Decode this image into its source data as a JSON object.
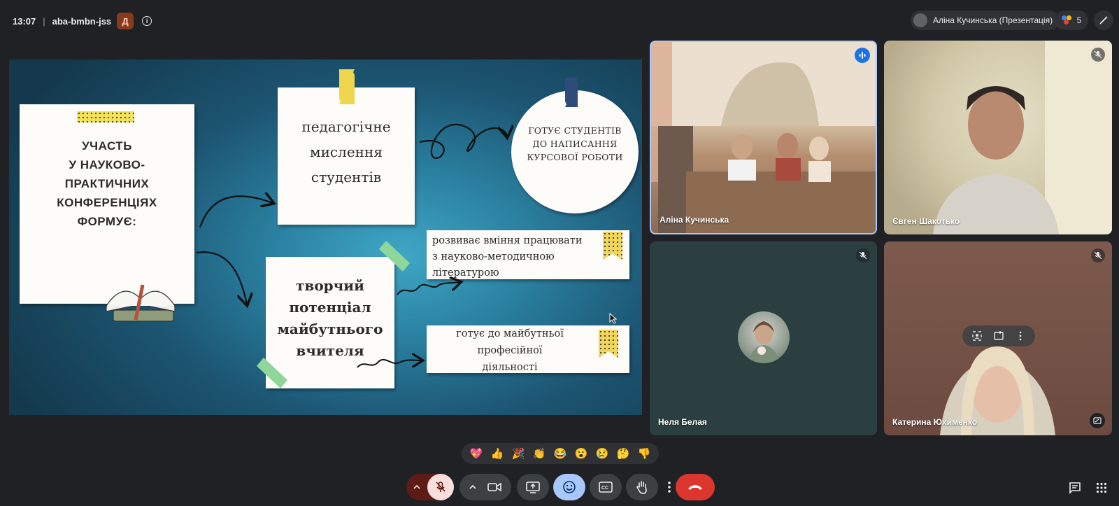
{
  "meeting": {
    "time": "13:07",
    "code": "aba-bmbn-jss",
    "host_badge": "Д",
    "info_icon": "info-icon"
  },
  "presenter_chip": {
    "label": "Аліна Кучинська (Презентація)"
  },
  "participants": {
    "count": "5"
  },
  "slide": {
    "main_title": [
      "УЧАСТЬ",
      "У НАУКОВО-",
      "ПРАКТИЧНИХ",
      "КОНФЕРЕНЦІЯХ",
      "ФОРМУЄ:"
    ],
    "card_ped": [
      "педагогічне",
      "мислення",
      "студентів"
    ],
    "circle": [
      "ГОТУЄ СТУДЕНТІВ",
      "ДО НАПИСАННЯ",
      "КУРСОВОЇ РОБОТИ"
    ],
    "card_tv": [
      "творчий",
      "потенціал",
      "майбутнього",
      "вчителя"
    ],
    "card_r1": [
      "розвиває вміння працювати",
      "з науково-методичною",
      "літературою"
    ],
    "card_r2": [
      "готує до майбутньої",
      "професійної",
      "діяльності"
    ]
  },
  "tiles": [
    {
      "name": "Аліна Кучинська",
      "state": "speaking"
    },
    {
      "name": "Євген Шакотько",
      "state": "muted"
    },
    {
      "name": "Неля Белая",
      "state": "muted"
    },
    {
      "name": "Катерина Юхименко",
      "state": "muted"
    }
  ],
  "reactions": [
    "💖",
    "👍",
    "🎉",
    "👏",
    "😂",
    "😮",
    "😢",
    "🤔",
    "👎"
  ],
  "colors": {
    "accent_blue": "#a8c7fa",
    "end_call_red": "#dc362e",
    "mic_muted_bg": "#f9dedc"
  },
  "controls": {
    "mic": "mic-off-icon",
    "camera": "videocam-icon",
    "present": "present-screen-icon",
    "reactions": "emoji-icon",
    "captions": "closed-captions-icon",
    "raise_hand": "hand-icon",
    "more": "more-vert-icon",
    "end_call": "call-end-icon",
    "chat": "chat-icon",
    "activities": "apps-grid-icon"
  }
}
